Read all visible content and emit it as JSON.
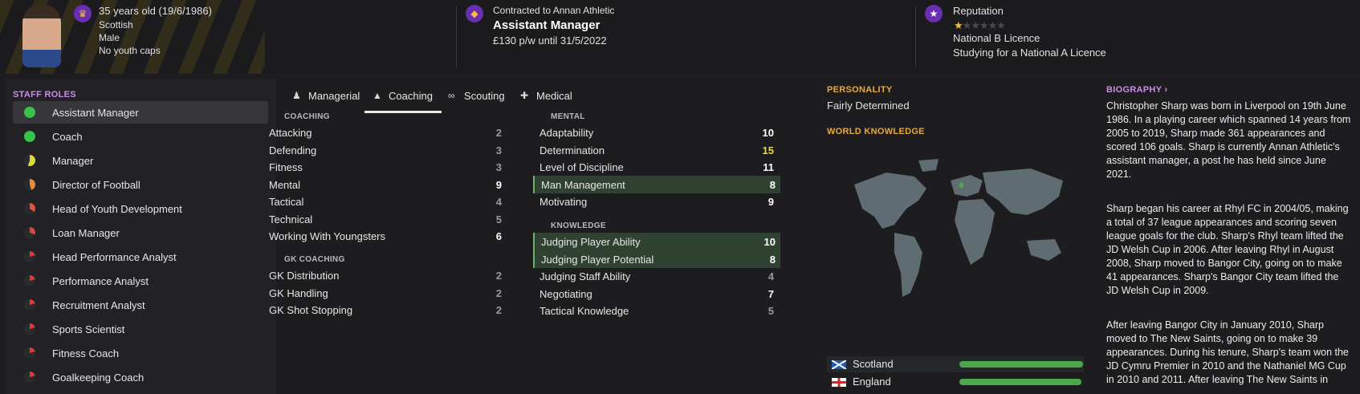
{
  "header": {
    "age": "35 years old (19/6/1986)",
    "nationality": "Scottish",
    "gender": "Male",
    "caps": "No youth caps",
    "contract_line": "Contracted to Annan Athletic",
    "job_title": "Assistant Manager",
    "wage": "£130 p/w until 31/5/2022",
    "reputation_label": "Reputation",
    "reputation_stars": 0.5,
    "licence": "National B Licence",
    "studying": "Studying for a National A Licence"
  },
  "staff_roles": {
    "title": "STAFF ROLES",
    "items": [
      {
        "label": "Assistant Manager",
        "selected": true,
        "suitability": 1.0
      },
      {
        "label": "Coach",
        "selected": false,
        "suitability": 0.95
      },
      {
        "label": "Manager",
        "selected": false,
        "suitability": 0.55
      },
      {
        "label": "Director of Football",
        "selected": false,
        "suitability": 0.45
      },
      {
        "label": "Head of Youth Development",
        "selected": false,
        "suitability": 0.35
      },
      {
        "label": "Loan Manager",
        "selected": false,
        "suitability": 0.3
      },
      {
        "label": "Head Performance Analyst",
        "selected": false,
        "suitability": 0.2
      },
      {
        "label": "Performance Analyst",
        "selected": false,
        "suitability": 0.2
      },
      {
        "label": "Recruitment Analyst",
        "selected": false,
        "suitability": 0.2
      },
      {
        "label": "Sports Scientist",
        "selected": false,
        "suitability": 0.2
      },
      {
        "label": "Fitness Coach",
        "selected": false,
        "suitability": 0.2
      },
      {
        "label": "Goalkeeping Coach",
        "selected": false,
        "suitability": 0.2
      }
    ]
  },
  "tabs": [
    {
      "label": "Managerial",
      "icon": "managerial-icon",
      "active": false
    },
    {
      "label": "Coaching",
      "icon": "coaching-cone-icon",
      "active": true
    },
    {
      "label": "Scouting",
      "icon": "binoculars-icon",
      "active": false
    },
    {
      "label": "Medical",
      "icon": "medical-kit-icon",
      "active": false
    }
  ],
  "coaching": {
    "title": "COACHING",
    "items": [
      {
        "name": "Attacking",
        "value": 2
      },
      {
        "name": "Defending",
        "value": 3
      },
      {
        "name": "Fitness",
        "value": 3
      },
      {
        "name": "Mental",
        "value": 9
      },
      {
        "name": "Tactical",
        "value": 4
      },
      {
        "name": "Technical",
        "value": 5
      },
      {
        "name": "Working With Youngsters",
        "value": 6
      }
    ]
  },
  "gk_coaching": {
    "title": "GK COACHING",
    "items": [
      {
        "name": "GK Distribution",
        "value": 2
      },
      {
        "name": "GK Handling",
        "value": 2
      },
      {
        "name": "GK Shot Stopping",
        "value": 2
      }
    ]
  },
  "mental": {
    "title": "MENTAL",
    "items": [
      {
        "name": "Adaptability",
        "value": 10,
        "highlight": false
      },
      {
        "name": "Determination",
        "value": 15,
        "highlight": false
      },
      {
        "name": "Level of Discipline",
        "value": 11,
        "highlight": false
      },
      {
        "name": "Man Management",
        "value": 8,
        "highlight": true
      },
      {
        "name": "Motivating",
        "value": 9,
        "highlight": false
      }
    ]
  },
  "knowledge": {
    "title": "KNOWLEDGE",
    "items": [
      {
        "name": "Judging Player Ability",
        "value": 10,
        "highlight": true
      },
      {
        "name": "Judging Player Potential",
        "value": 8,
        "highlight": true
      },
      {
        "name": "Judging Staff Ability",
        "value": 4,
        "highlight": false
      },
      {
        "name": "Negotiating",
        "value": 7,
        "highlight": false
      },
      {
        "name": "Tactical Knowledge",
        "value": 5,
        "highlight": false
      }
    ]
  },
  "personality": {
    "title": "PERSONALITY",
    "value": "Fairly Determined"
  },
  "world_knowledge": {
    "title": "WORLD KNOWLEDGE",
    "nations": [
      {
        "name": "Scotland",
        "knowledge": 1.0,
        "flag": "scotland-flag-icon"
      },
      {
        "name": "England",
        "knowledge": 0.99,
        "flag": "england-flag-icon"
      }
    ]
  },
  "biography": {
    "title": "BIOGRAPHY ›",
    "paragraphs": [
      "Christopher Sharp was born in Liverpool on 19th June 1986. In a playing career which spanned 14 years from 2005 to 2019, Sharp made 361 appearances and scored 106 goals. Sharp is currently Annan Athletic's assistant manager, a post he has held since June 2021.",
      "Sharp began his career at Rhyl FC in 2004/05, making a total of 37 league appearances and scoring seven league goals for the club. Sharp's Rhyl team lifted the JD Welsh Cup in 2006. After leaving Rhyl in August 2008, Sharp moved to Bangor City, going on to make 41 appearances. Sharp's Bangor City team lifted the JD Welsh Cup in 2009.",
      "After leaving Bangor City in January 2010, Sharp moved to The New Saints, going on to make 39 appearances. During his tenure, Sharp's team won the JD Cymru Premier in 2010 and the Nathaniel MG Cup in 2010 and 2011. After leaving The New Saints in"
    ]
  },
  "colors": {
    "section_title_orange": "#e8a93c",
    "section_title_purple": "#c98de8",
    "staff_roles_title": "#c98de8",
    "highlight_row": "#2f4232",
    "value_yellow": "#e9dc35",
    "bar_green": "#4aa84a"
  }
}
